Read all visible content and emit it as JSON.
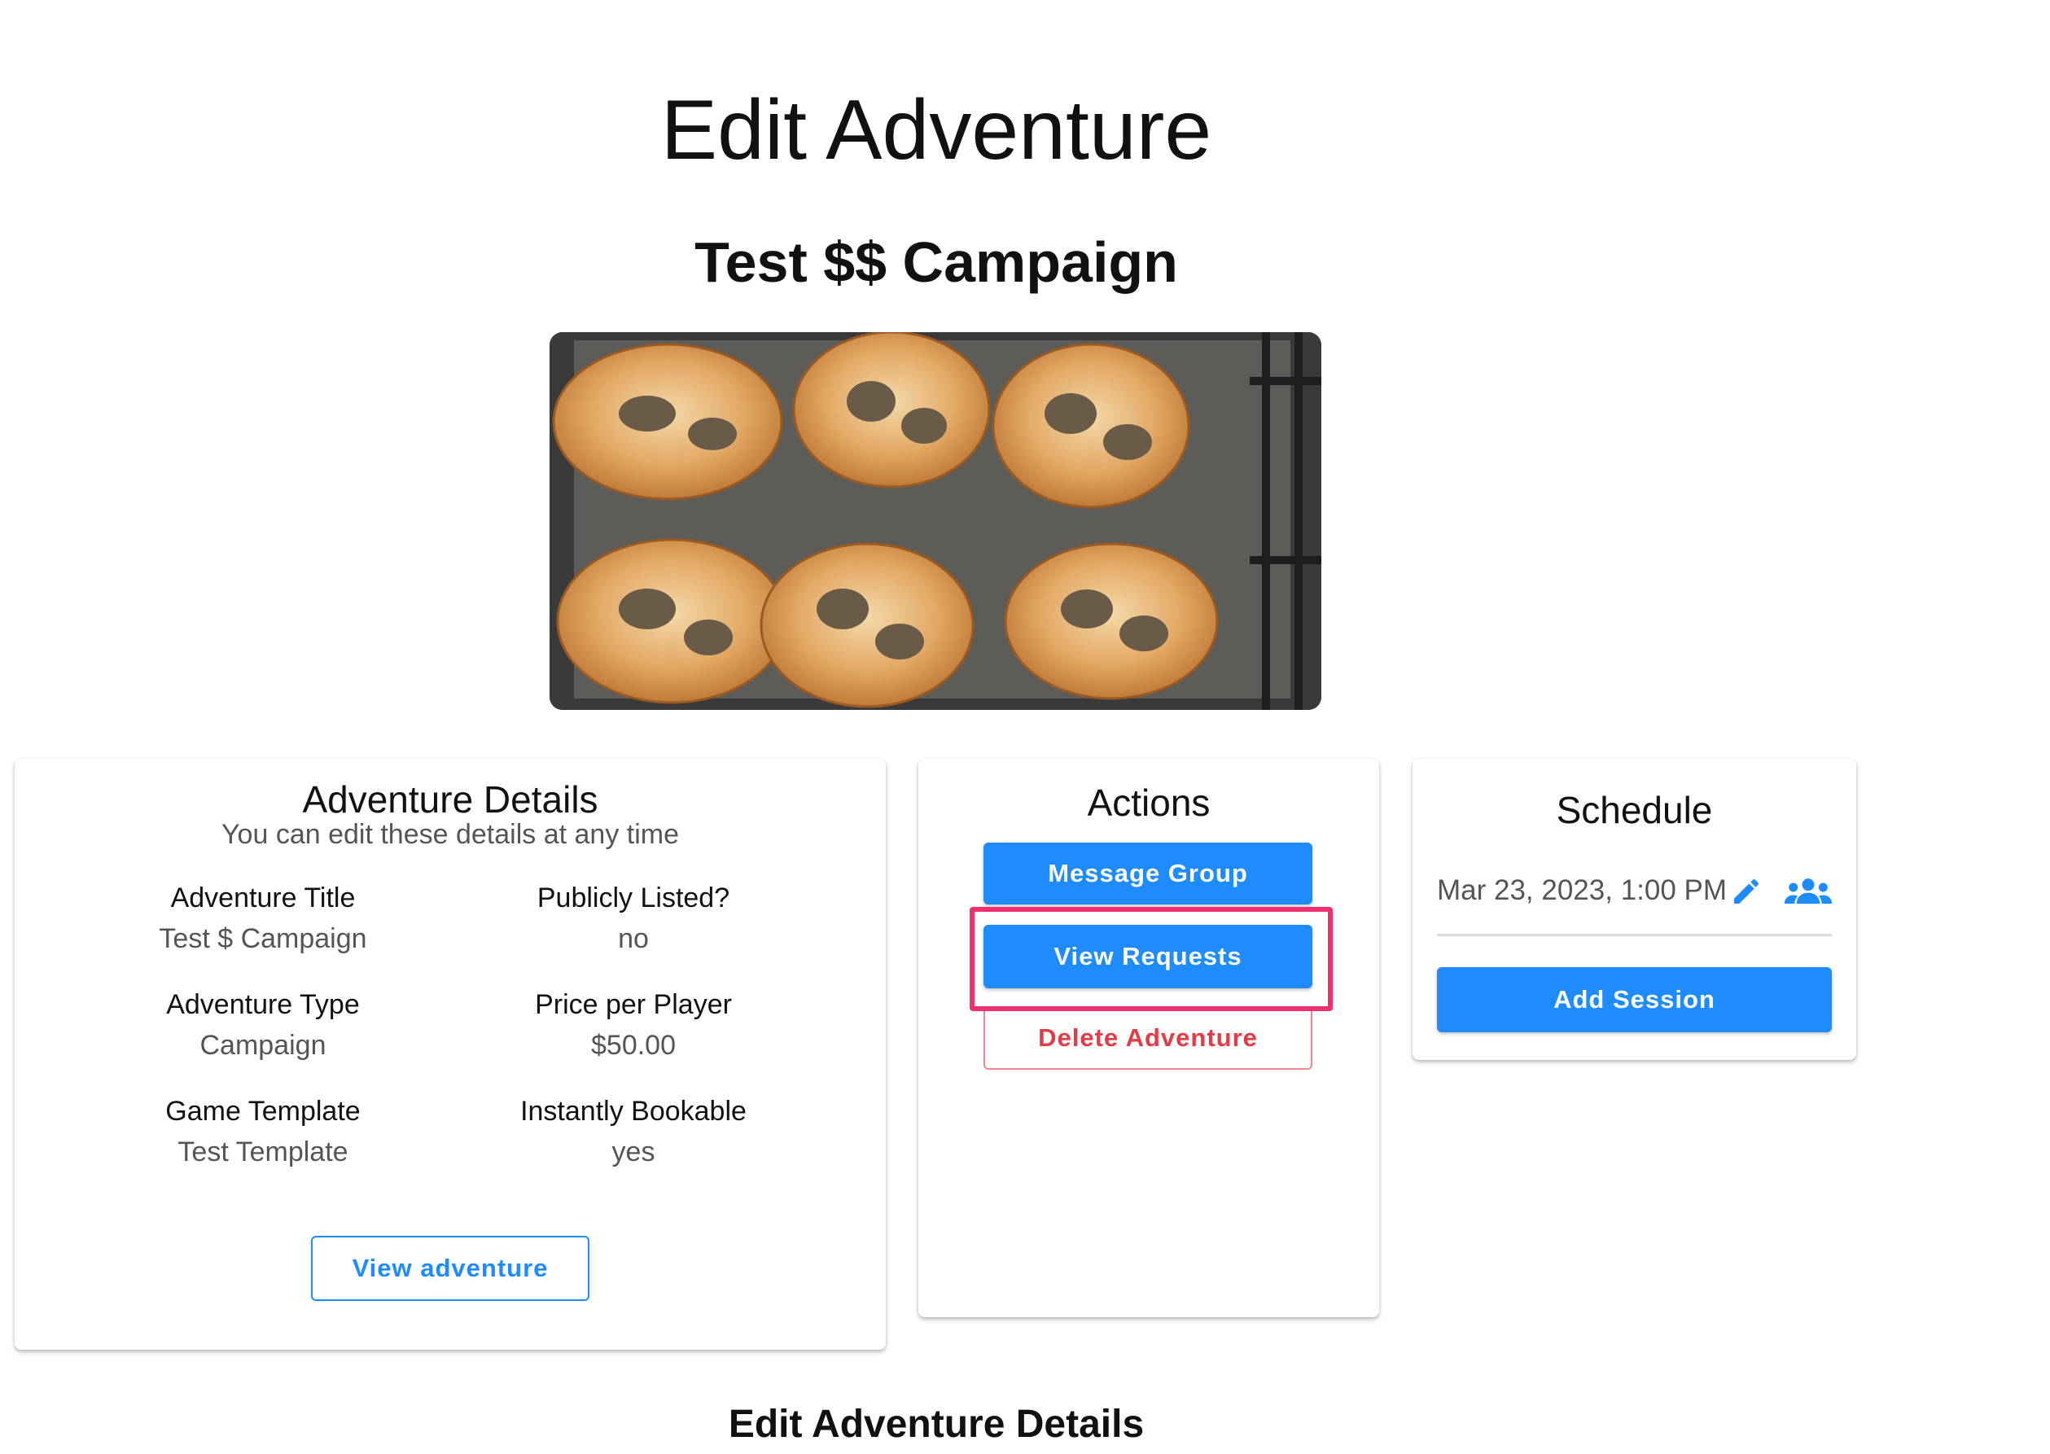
{
  "page": {
    "title": "Edit Adventure",
    "adventure_name": "Test $$ Campaign",
    "bottom_heading": "Edit Adventure Details"
  },
  "details_card": {
    "title": "Adventure Details",
    "subtitle": "You can edit these details at any time",
    "fields": [
      {
        "label": "Adventure Title",
        "value": "Test $ Campaign"
      },
      {
        "label": "Publicly Listed?",
        "value": "no"
      },
      {
        "label": "Adventure Type",
        "value": "Campaign"
      },
      {
        "label": "Price per Player",
        "value": "$50.00"
      },
      {
        "label": "Game Template",
        "value": "Test Template"
      },
      {
        "label": "Instantly Bookable",
        "value": "yes"
      }
    ],
    "view_button": "View adventure"
  },
  "actions_card": {
    "title": "Actions",
    "message_group": "Message Group",
    "view_requests": "View Requests",
    "delete_adventure": "Delete Adventure"
  },
  "schedule_card": {
    "title": "Schedule",
    "sessions": [
      {
        "datetime": "Mar 23, 2023, 1:00 PM",
        "icons": [
          "pencil-icon",
          "group-icon"
        ]
      }
    ],
    "add_session": "Add Session"
  },
  "colors": {
    "primary": "#1e8cff",
    "danger": "#e53b47",
    "highlight": "#f0306e"
  }
}
